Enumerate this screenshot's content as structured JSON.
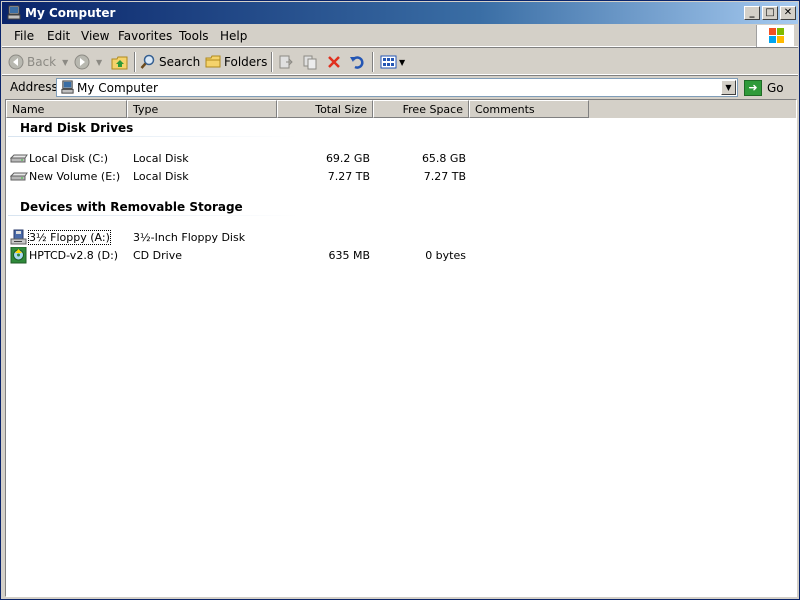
{
  "window": {
    "title": "My Computer",
    "controls": {
      "minimize": "_",
      "maximize": "□",
      "close": "✕"
    }
  },
  "menu": {
    "items": [
      "File",
      "Edit",
      "View",
      "Favorites",
      "Tools",
      "Help"
    ]
  },
  "toolbar": {
    "back_label": "Back",
    "search_label": "Search",
    "folders_label": "Folders"
  },
  "address": {
    "label": "Address",
    "value": "My Computer",
    "go_label": "Go"
  },
  "columns": [
    "Name",
    "Type",
    "Total Size",
    "Free Space",
    "Comments"
  ],
  "groups": [
    {
      "title": "Hard Disk Drives",
      "items": [
        {
          "name": "Local Disk (C:)",
          "type": "Local Disk",
          "total": "69.2 GB",
          "free": "65.8 GB",
          "icon": "hard-drive-icon"
        },
        {
          "name": "New Volume (E:)",
          "type": "Local Disk",
          "total": "7.27 TB",
          "free": "7.27 TB",
          "icon": "hard-drive-icon"
        }
      ]
    },
    {
      "title": "Devices with Removable Storage",
      "items": [
        {
          "name": "3½ Floppy (A:)",
          "type": "3½-Inch Floppy Disk",
          "total": "",
          "free": "",
          "icon": "floppy-drive-icon"
        },
        {
          "name": "HPTCD-v2.8 (D:)",
          "type": "CD Drive",
          "total": "635 MB",
          "free": "0 bytes",
          "icon": "cd-drive-icon"
        }
      ]
    }
  ],
  "colors": {
    "title_gradient_start": "#0a246a",
    "title_gradient_end": "#a6caf0",
    "chrome": "#d4d0c8",
    "go_green": "#2f9a3a"
  }
}
